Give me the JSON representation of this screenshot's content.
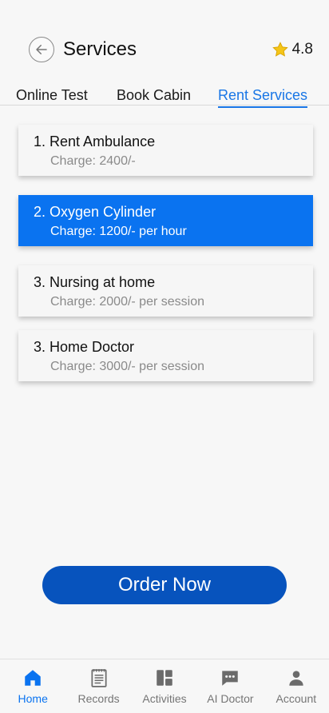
{
  "header": {
    "title": "Services",
    "rating": "4.8",
    "back_icon": "back-arrow-icon",
    "star_icon": "star-icon",
    "star_color": "#f5c518"
  },
  "tabs": [
    {
      "label": "Online Test",
      "active": false
    },
    {
      "label": "Book Cabin",
      "active": false
    },
    {
      "label": "Rent Services",
      "active": true
    }
  ],
  "services": [
    {
      "name": "1. Rent Ambulance",
      "charge": "Charge: 2400/-",
      "selected": false
    },
    {
      "name": "2. Oxygen Cylinder",
      "charge": "Charge: 1200/- per hour",
      "selected": true
    },
    {
      "name": "3. Nursing at home",
      "charge": "Charge: 2000/- per session",
      "selected": false
    },
    {
      "name": "3. Home Doctor",
      "charge": "Charge: 3000/- per session",
      "selected": false
    }
  ],
  "order_button": {
    "label": "Order Now"
  },
  "bottom_nav": [
    {
      "label": "Home",
      "icon": "home-icon",
      "active": true
    },
    {
      "label": "Records",
      "icon": "records-icon",
      "active": false
    },
    {
      "label": "Activities",
      "icon": "dashboard-icon",
      "active": false
    },
    {
      "label": "AI Doctor",
      "icon": "chat-icon",
      "active": false
    },
    {
      "label": "Account",
      "icon": "person-icon",
      "active": false
    }
  ],
  "colors": {
    "accent": "#0a73f0",
    "tab_active": "#1976e6",
    "button": "#0753bd",
    "muted_text": "#8a8a8a"
  }
}
